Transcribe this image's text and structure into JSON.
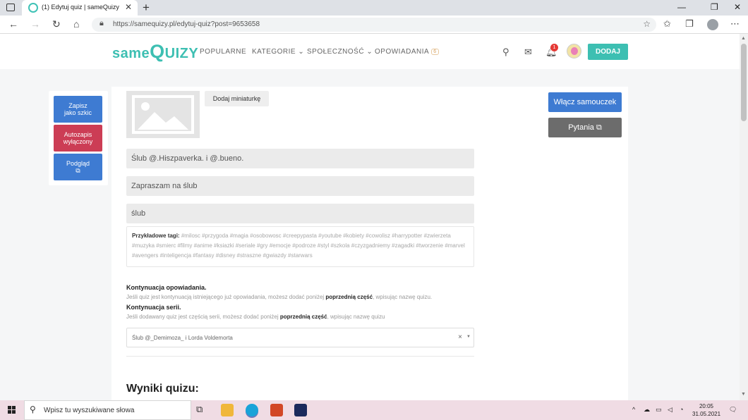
{
  "browser": {
    "tab_title": "(1) Edytuj quiz | sameQuizy",
    "tab_close": "✕",
    "new_tab": "+",
    "url": "https://samequizy.pl/edytuj-quiz?post=9653658",
    "controls": {
      "minimize": "—",
      "maximize": "❐",
      "close": "✕"
    }
  },
  "site": {
    "logo_a": "same",
    "logo_b": "Q",
    "logo_c": "UIZY",
    "nav": [
      {
        "label": "POPULARNE"
      },
      {
        "label": "KATEGORIE"
      },
      {
        "label": "SPOŁECZNOŚĆ"
      },
      {
        "label": "OPOWIADANIA",
        "badge": "6"
      }
    ],
    "notification_count": "1",
    "add_button": "DODAJ"
  },
  "sidebar": {
    "save_draft": [
      "Zapisz",
      "jako szkic"
    ],
    "autosave": [
      "Autozapis",
      "wyłączony"
    ],
    "preview": "Podgląd",
    "colors": {
      "save": "#3e7bd2",
      "autosave": "#cc3d55",
      "preview": "#3e7bd2"
    }
  },
  "editor": {
    "add_thumbnail": "Dodaj miniaturkę",
    "tutorial_button": "Włącz samouczek",
    "questions_button": "Pytania",
    "title_value": "Ślub @.Hiszpaverka. i @.bueno.",
    "description_value": "Zapraszam na ślub",
    "tags_value": "ślub",
    "example_tags_label": "Przykładowe tagi:",
    "example_tags": "#milosc #przygoda #magia #osobowosc #creepypasta #youtube #kobiety #cowolisz #harrypotter #zwierzeta #muzyka #smierc #filmy #anime #ksiazki #seriale #gry #emocje #podroze #styl #szkola #czyzgadniemy #zagadki #tworzenie #marvel #avengers #inteligencja #fantasy #disney #straszne #gwiazdy #starwars",
    "story_continuation_title": "Kontynuacja opowiadania.",
    "story_continuation_pre": "Jeśli quiz jest kontynuacją istniejącego już opowiadania, możesz dodać poniżej ",
    "story_continuation_bold": "poprzednią część",
    "story_continuation_post": ", wpisując nazwę quizu.",
    "series_continuation_title": "Kontynuacja serii.",
    "series_continuation_pre": "Jeśli dodawany quiz jest częścią serii, możesz dodać poniżej ",
    "series_continuation_bold": "poprzednią część",
    "series_continuation_post": ", wpisując nazwę quizu",
    "previous_part_value": "Ślub @_Demimoza_ i Lorda Voldemorta",
    "results_heading": "Wyniki quizu:"
  },
  "taskbar": {
    "search_placeholder": "Wpisz tu wyszukiwane słowa",
    "time": "20:05",
    "date": "31.05.2021"
  }
}
